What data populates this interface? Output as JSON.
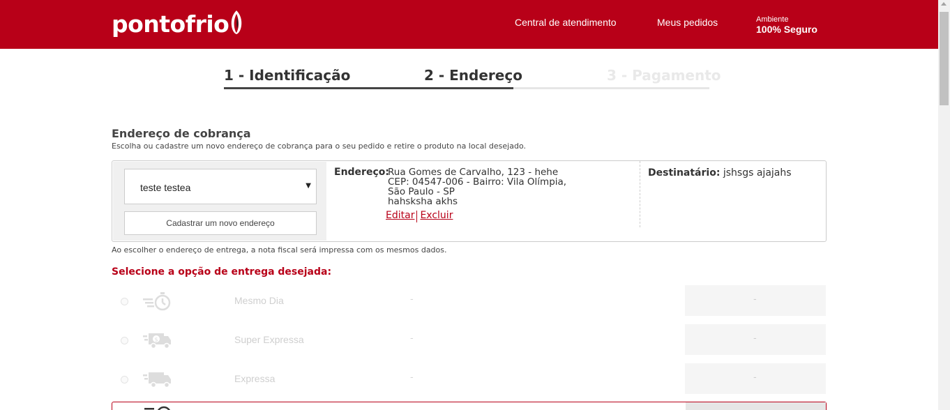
{
  "header": {
    "logo": "pontofrio",
    "nav": {
      "central": "Central de atendimento",
      "pedidos": "Meus pedidos"
    },
    "secure": {
      "small": "Ambiente",
      "big": "100% Seguro"
    },
    "brand_color": "#b80018"
  },
  "steps": [
    {
      "label": "1 - Identificação",
      "state": "done"
    },
    {
      "label": "2 - Endereço",
      "state": "current"
    },
    {
      "label": "3 - Pagamento",
      "state": "pending"
    }
  ],
  "billing": {
    "title": "Endereço de cobrança",
    "description": "Escolha ou cadastre um novo endereço de cobrança para o seu pedido e retire o produto na local desejado.",
    "selected_address": "teste testea",
    "new_address_button": "Cadastrar um novo endereço",
    "address_label": "Endereço:",
    "address_lines": [
      "Rua Gomes de Carvalho, 123 - hehe",
      "CEP: 04547-006 - Bairro: Vila Olímpia,",
      "São Paulo - SP",
      "hahsksha akhs"
    ],
    "edit_link": "Editar",
    "delete_link": "Excluir",
    "recipient_label": "Destinatário:",
    "recipient_name": "jshsgs ajajahs",
    "note": "Ao escolher o endereço de entrega, a nota fiscal será impressa com os mesmos dados."
  },
  "delivery": {
    "title": "Selecione a opção de entrega desejada:",
    "options": [
      {
        "name": "Mesmo Dia",
        "time": "-",
        "price": "-",
        "icon": "stopwatch-icon"
      },
      {
        "name": "Super Expressa",
        "time": "-",
        "price": "-",
        "icon": "money-truck-icon"
      },
      {
        "name": "Expressa",
        "time": "-",
        "price": "-",
        "icon": "truck-icon"
      }
    ]
  }
}
